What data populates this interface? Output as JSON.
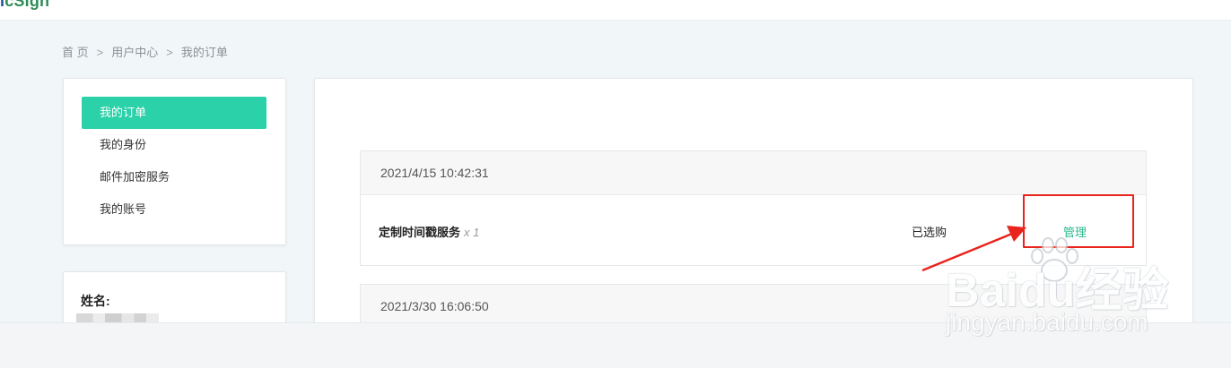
{
  "header": {
    "logo_dark": "i",
    "logo_light": "cSign"
  },
  "breadcrumb": {
    "home": "首 页",
    "separator": ">",
    "user_center": "用户中心",
    "current": "我的订单"
  },
  "sidebar": {
    "items": [
      {
        "label": "我的订单",
        "active": true
      },
      {
        "label": "我的身份",
        "active": false
      },
      {
        "label": "邮件加密服务",
        "active": false
      },
      {
        "label": "我的账号",
        "active": false
      }
    ]
  },
  "profile": {
    "name_label": "姓名:"
  },
  "orders": [
    {
      "timestamp": "2021/4/15 10:42:31",
      "product": "定制时间戳服务",
      "quantity": "x 1",
      "status": "已选购",
      "action": "管理"
    },
    {
      "timestamp": "2021/3/30 16:06:50"
    }
  ],
  "watermark": {
    "brand": "Baidu经验",
    "site": "jingyan.baidu.com"
  },
  "colors": {
    "accent": "#2bd1a8",
    "link": "#2bb98f",
    "annotation": "#e8241c"
  }
}
